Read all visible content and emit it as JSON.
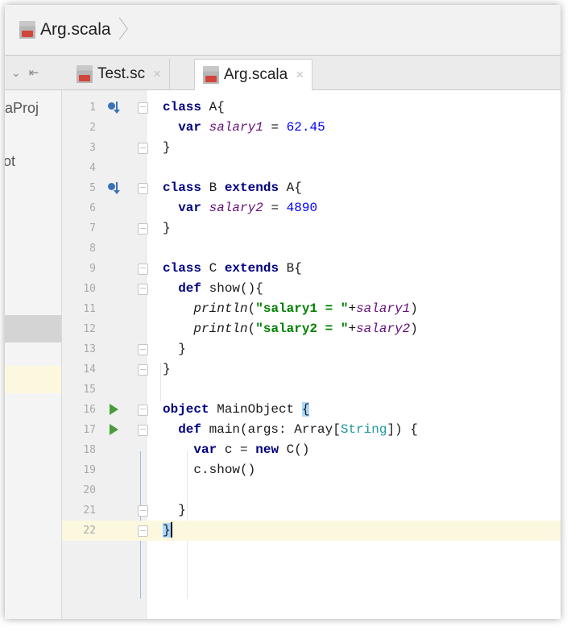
{
  "breadcrumb": {
    "file": "Arg.scala",
    "icon": "scala-file-icon"
  },
  "tabs": [
    {
      "label": "Test.sc",
      "close": "×",
      "active": false
    },
    {
      "label": "Arg.scala",
      "close": "×",
      "active": true
    }
  ],
  "project_panel": {
    "item1": "aProj",
    "item2": "ot"
  },
  "editor": {
    "current_line": 22,
    "lines": [
      {
        "n": "1",
        "gutter": "override"
      },
      {
        "n": "2"
      },
      {
        "n": "3"
      },
      {
        "n": "4"
      },
      {
        "n": "5",
        "gutter": "override"
      },
      {
        "n": "6"
      },
      {
        "n": "7"
      },
      {
        "n": "8"
      },
      {
        "n": "9"
      },
      {
        "n": "10"
      },
      {
        "n": "11"
      },
      {
        "n": "12"
      },
      {
        "n": "13"
      },
      {
        "n": "14"
      },
      {
        "n": "15"
      },
      {
        "n": "16",
        "gutter": "run"
      },
      {
        "n": "17",
        "gutter": "run"
      },
      {
        "n": "18"
      },
      {
        "n": "19"
      },
      {
        "n": "20"
      },
      {
        "n": "21"
      },
      {
        "n": "22"
      }
    ],
    "code": {
      "l1": {
        "kw": "class",
        "rest": " A{"
      },
      "l2": {
        "kw": "var",
        "field": "salary1",
        "op": " = ",
        "num": "62.45"
      },
      "l3": {
        "text": "}"
      },
      "l5": {
        "kw": "class",
        "mid": " B ",
        "kw2": "extends",
        "rest": " A{"
      },
      "l6": {
        "kw": "var",
        "field": "salary2",
        "op": " = ",
        "num": "4890"
      },
      "l7": {
        "text": "}"
      },
      "l9": {
        "kw": "class",
        "mid": " C ",
        "kw2": "extends",
        "rest": " B{"
      },
      "l10": {
        "kw": "def",
        "rest": " show(){"
      },
      "l11": {
        "fn": "println",
        "open": "(",
        "str": "\"salary1 = \"",
        "plus": "+",
        "field": "salary1",
        "close": ")"
      },
      "l12": {
        "fn": "println",
        "open": "(",
        "str": "\"salary2 = \"",
        "plus": "+",
        "field": "salary2",
        "close": ")"
      },
      "l13": {
        "text": "}"
      },
      "l14": {
        "text": "}"
      },
      "l16": {
        "kw": "object",
        "rest": " MainObject ",
        "brace": "{"
      },
      "l17": {
        "kw": "def",
        "rest": " main(args: Array[",
        "type": "String",
        "rest2": "]) {"
      },
      "l18": {
        "kw": "var",
        "mid": " c = ",
        "kw2": "new",
        "rest": " C()"
      },
      "l19": {
        "text": "c.show()"
      },
      "l21": {
        "text": "}"
      },
      "l22": {
        "text": "}"
      }
    }
  },
  "colors": {
    "keyword": "#000080",
    "field": "#660e7a",
    "string": "#008000",
    "number": "#0000ff",
    "type": "#20999d",
    "current_line": "#fcf8df",
    "run": "#4a9c3a",
    "override": "#3a72b9"
  }
}
